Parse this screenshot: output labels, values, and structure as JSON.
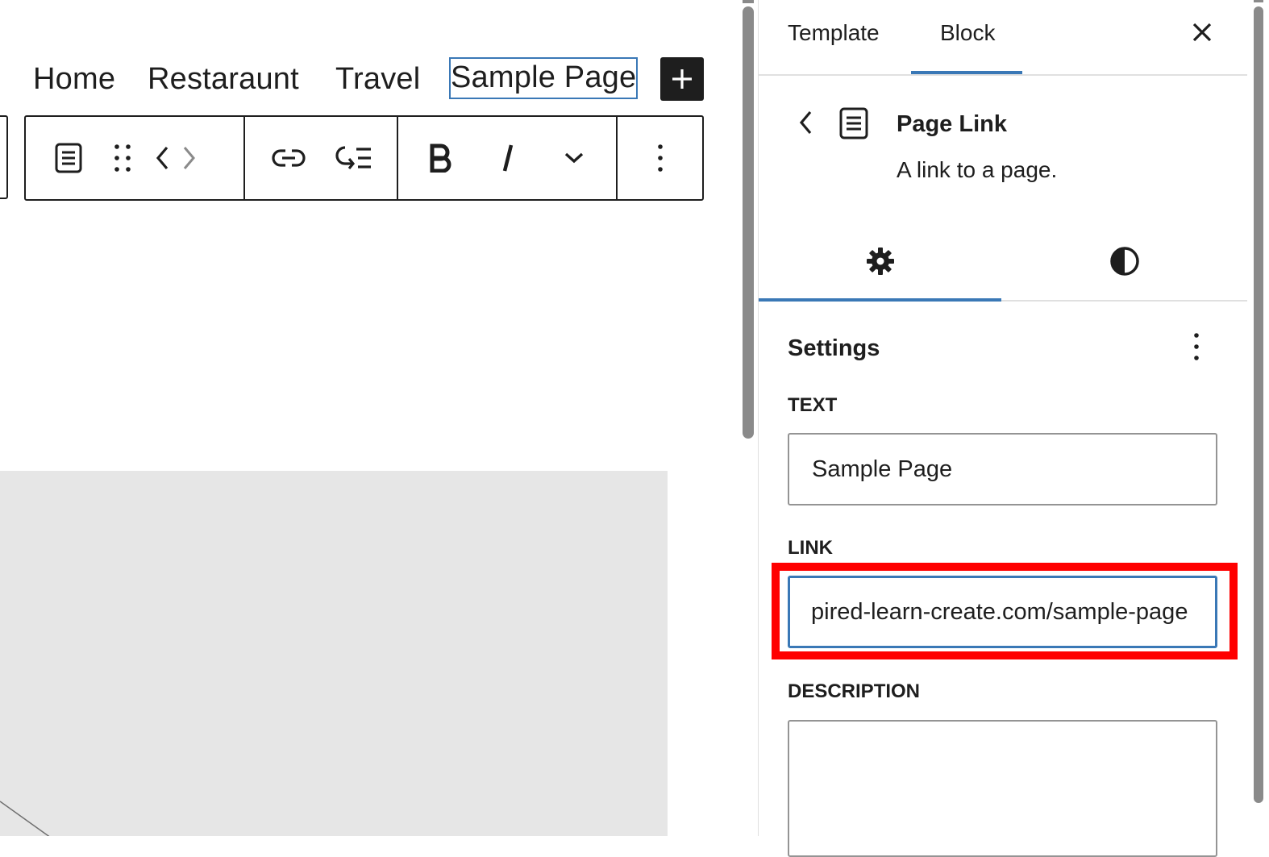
{
  "nav": {
    "items": [
      "Home",
      "Restaraunt",
      "Travel",
      "Sample Page"
    ]
  },
  "toolbar": {
    "buttons": [
      {
        "name": "page-link-block-icon",
        "label": "Page Link"
      },
      {
        "name": "drag-handle-icon",
        "label": "Drag"
      },
      {
        "name": "move-left-icon",
        "label": "Move left"
      },
      {
        "name": "move-right-icon",
        "label": "Move right"
      },
      {
        "name": "link-icon",
        "label": "Link"
      },
      {
        "name": "add-submenu-icon",
        "label": "Add submenu"
      },
      {
        "name": "bold-icon",
        "label": "Bold"
      },
      {
        "name": "italic-icon",
        "label": "Italic"
      },
      {
        "name": "chevron-down-icon",
        "label": "More"
      },
      {
        "name": "more-vertical-icon",
        "label": "Options"
      }
    ]
  },
  "sidebar": {
    "tabs": [
      "Template",
      "Block"
    ],
    "active_tab": "Block",
    "block": {
      "title": "Page Link",
      "description": "A link to a page."
    },
    "inspector_tabs": [
      "settings",
      "styles"
    ],
    "settings": {
      "title": "Settings",
      "text_label": "TEXT",
      "text_value": "Sample Page",
      "link_label": "LINK",
      "link_value": "pired-learn-create.com/sample-page",
      "description_label": "DESCRIPTION",
      "description_value": ""
    }
  },
  "colors": {
    "accent": "#3a78b6",
    "highlight": "#ff0000",
    "dark": "#1e1e1e",
    "placeholder_bg": "#e6e6e6"
  }
}
